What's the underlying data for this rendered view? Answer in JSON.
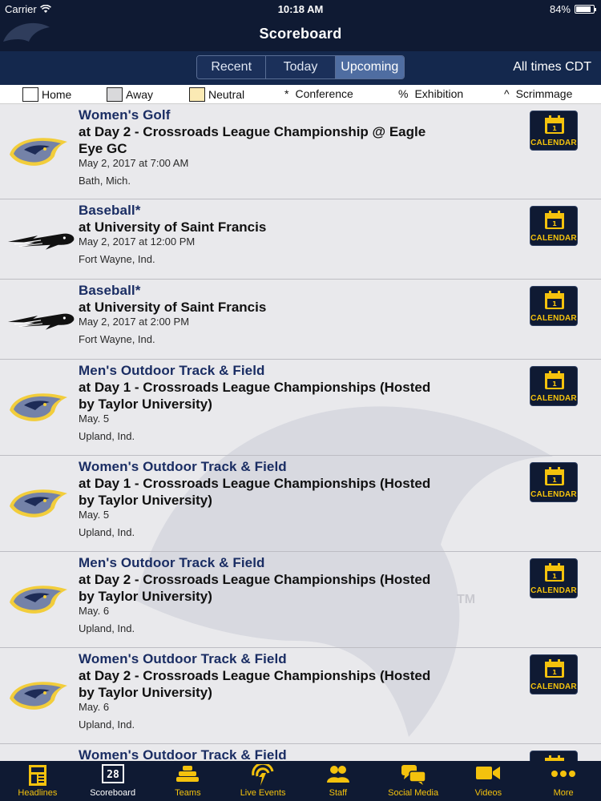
{
  "status_bar": {
    "carrier": "Carrier",
    "time": "10:18 AM",
    "battery": "84%",
    "battery_level": 0.84
  },
  "header": {
    "title": "Scoreboard"
  },
  "segments": {
    "items": [
      "Recent",
      "Today",
      "Upcoming"
    ],
    "active": "Upcoming"
  },
  "times_note": "All times CDT",
  "legend": {
    "home": "Home",
    "away": "Away",
    "neutral": "Neutral",
    "conference_symbol": "*",
    "conference": "Conference",
    "exhibition_symbol": "%",
    "exhibition": "Exhibition",
    "scrimmage_symbol": "^",
    "scrimmage": "Scrimmage"
  },
  "calendar": {
    "label": "CALENDAR",
    "day": "1"
  },
  "events": [
    {
      "sport": "Women's Golf",
      "opponent": "at Day 2 - Crossroads League Championship @ Eagle Eye GC",
      "datetime": "May 2, 2017 at 7:00 AM",
      "location": "Bath, Mich.",
      "logo": "eagle-logo"
    },
    {
      "sport": "Baseball*",
      "opponent": "at University of Saint Francis",
      "datetime": "May 2, 2017 at 12:00 PM",
      "location": "Fort Wayne, Ind.",
      "logo": "cougar-logo"
    },
    {
      "sport": "Baseball*",
      "opponent": "at University of Saint Francis",
      "datetime": "May 2, 2017 at 2:00 PM",
      "location": "Fort Wayne, Ind.",
      "logo": "cougar-logo"
    },
    {
      "sport": "Men's Outdoor Track & Field",
      "opponent": "at Day 1 - Crossroads League Championships (Hosted by Taylor University)",
      "datetime": "May. 5",
      "location": "Upland, Ind.",
      "logo": "eagle-logo"
    },
    {
      "sport": "Women's Outdoor Track & Field",
      "opponent": "at Day 1 - Crossroads League Championships (Hosted by Taylor University)",
      "datetime": "May. 5",
      "location": "Upland, Ind.",
      "logo": "eagle-logo"
    },
    {
      "sport": "Men's Outdoor Track & Field",
      "opponent": "at Day 2 - Crossroads League Championships (Hosted by Taylor University)",
      "datetime": "May. 6",
      "location": "Upland, Ind.",
      "logo": "eagle-logo"
    },
    {
      "sport": "Women's Outdoor Track & Field",
      "opponent": "at Day 2 - Crossroads League Championships (Hosted by Taylor University)",
      "datetime": "May. 6",
      "location": "Upland, Ind.",
      "logo": "eagle-logo"
    },
    {
      "sport": "Women's Outdoor Track & Field",
      "opponent": "",
      "datetime": "",
      "location": "",
      "logo": ""
    }
  ],
  "tabs": [
    {
      "label": "Headlines",
      "icon": "newspaper-icon"
    },
    {
      "label": "Scoreboard",
      "icon": "scoreboard-icon",
      "active": true
    },
    {
      "label": "Teams",
      "icon": "teams-icon"
    },
    {
      "label": "Live Events",
      "icon": "live-events-icon"
    },
    {
      "label": "Staff",
      "icon": "staff-icon"
    },
    {
      "label": "Social Media",
      "icon": "chat-bubbles-icon"
    },
    {
      "label": "Videos",
      "icon": "video-camera-icon"
    },
    {
      "label": "More",
      "icon": "more-dots-icon"
    }
  ],
  "colors": {
    "navy": "#0f1a33",
    "gold": "#f4c20d",
    "sport_blue": "#1a2d63"
  }
}
